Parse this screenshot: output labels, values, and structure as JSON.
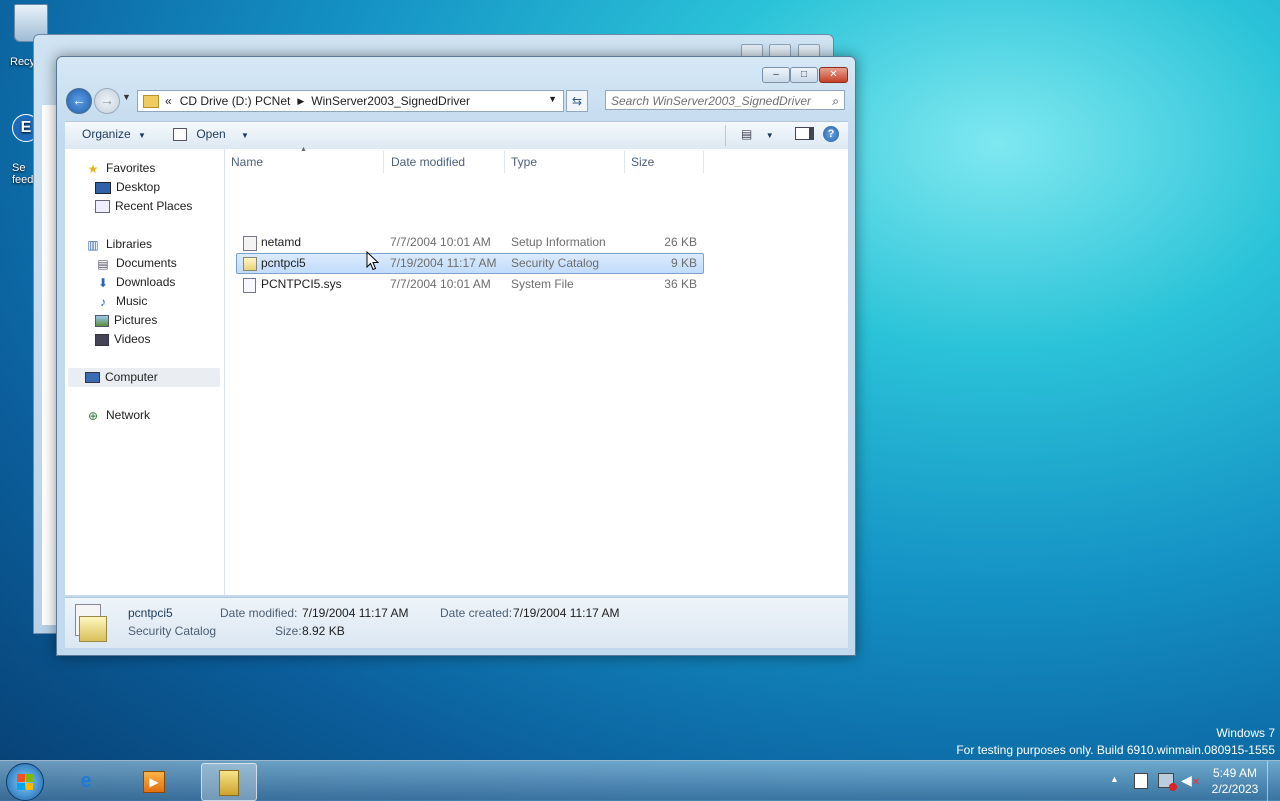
{
  "desktop": {
    "recycle_label": "Recy",
    "shortcut_label_1": "Se",
    "shortcut_label_2": "feed",
    "shortcut_glyph": "E"
  },
  "window_back": {
    "buttons": [
      "–",
      "□",
      "✕"
    ]
  },
  "window": {
    "controls": {
      "minimize": "–",
      "maximize": "□",
      "close": "✕"
    },
    "address": {
      "overflow": "«",
      "segments": [
        "CD Drive (D:) PCNet",
        "WinServer2003_SignedDriver"
      ]
    },
    "search_placeholder": "Search WinServer2003_SignedDriver",
    "toolbar": {
      "organize": "Organize",
      "open": "Open"
    },
    "nav": {
      "favorites": "Favorites",
      "favorites_items": [
        "Desktop",
        "Recent Places"
      ],
      "libraries": "Libraries",
      "libraries_items": [
        "Documents",
        "Downloads",
        "Music",
        "Pictures",
        "Videos"
      ],
      "computer": "Computer",
      "network": "Network"
    },
    "columns": {
      "name": "Name",
      "date": "Date modified",
      "type": "Type",
      "size": "Size"
    },
    "files": [
      {
        "name": "netamd",
        "date": "7/7/2004 10:01 AM",
        "type": "Setup Information",
        "size": "26 KB"
      },
      {
        "name": "pcntpci5",
        "date": "7/19/2004 11:17 AM",
        "type": "Security Catalog",
        "size": "9 KB"
      },
      {
        "name": "PCNTPCI5.sys",
        "date": "7/7/2004 10:01 AM",
        "type": "System File",
        "size": "36 KB"
      }
    ],
    "details": {
      "name": "pcntpci5",
      "type": "Security Catalog",
      "modified_label": "Date modified:",
      "modified": "7/19/2004 11:17 AM",
      "created_label": "Date created:",
      "created": "7/19/2004 11:17 AM",
      "size_label": "Size:",
      "size": "8.92 KB"
    }
  },
  "watermark": {
    "line1": "Windows  7",
    "line2": "For testing purposes only. Build 6910.winmain.080915-1555"
  },
  "taskbar": {
    "clock_time": "5:49 AM",
    "clock_date": "2/2/2023",
    "tray_arrow": "▲"
  },
  "colors": {
    "selection": "#c1dcfc",
    "window_frame": "#c2daee",
    "close_button": "#c6412a"
  }
}
